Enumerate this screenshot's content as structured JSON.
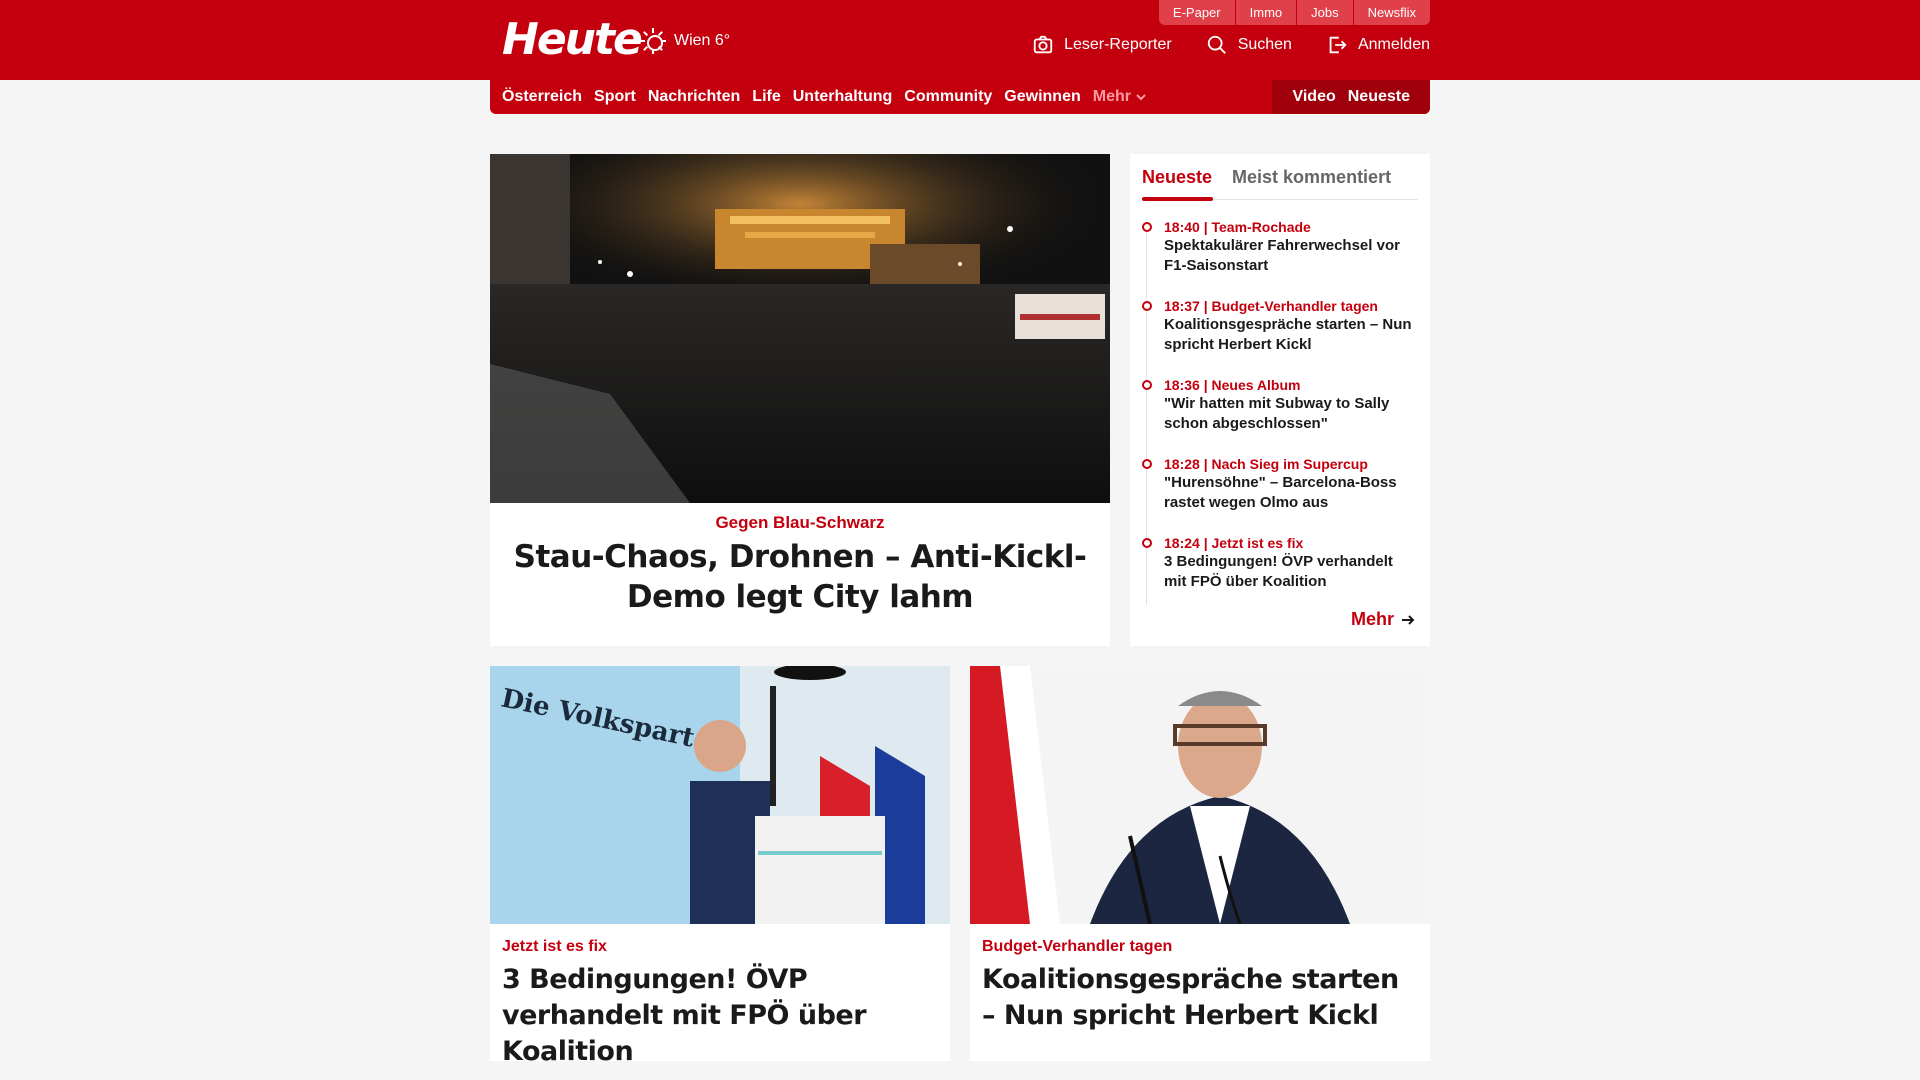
{
  "header": {
    "logo": "Heute",
    "weather": "Wien 6°",
    "top_links": [
      "E-Paper",
      "Immo",
      "Jobs",
      "Newsflix"
    ],
    "actions": {
      "reporter": "Leser-Reporter",
      "search": "Suchen",
      "login": "Anmelden"
    }
  },
  "nav": {
    "items": [
      "Österreich",
      "Sport",
      "Nachrichten",
      "Life",
      "Unterhaltung",
      "Community",
      "Gewinnen"
    ],
    "more": "Mehr",
    "right": [
      "Video",
      "Neueste"
    ]
  },
  "hero": {
    "kicker": "Gegen Blau-Schwarz",
    "title": "Stau-Chaos, Drohnen – Anti-Kickl-Demo legt City lahm"
  },
  "sidebar": {
    "tabs": [
      "Neueste",
      "Meist kommentiert"
    ],
    "items": [
      {
        "meta": "18:40 | Team-Rochade",
        "title": "Spektakulärer Fahrerwechsel vor F1-Saisonstart"
      },
      {
        "meta": "18:37 | Budget-Verhandler tagen",
        "title": "Koalitionsgespräche starten – Nun spricht Herbert Kickl"
      },
      {
        "meta": "18:36 | Neues Album",
        "title": "\"Wir hatten mit Subway to Sally schon abgeschlossen\""
      },
      {
        "meta": "18:28 | Nach Sieg im Supercup",
        "title": "\"Hurensöhne\" – Barcelona-Boss rastet wegen Olmo aus"
      },
      {
        "meta": "18:24 | Jetzt ist es fix",
        "title": "3 Bedingungen! ÖVP verhandelt mit FPÖ über Koalition"
      }
    ],
    "more": "Mehr"
  },
  "cards": [
    {
      "kicker": "Jetzt ist es fix",
      "title": "3 Bedingungen! ÖVP verhandelt mit FPÖ über Koalition",
      "image_text": "Die Volkspartei"
    },
    {
      "kicker": "Budget-Verhandler tagen",
      "title": "Koalitionsgespräche starten – Nun spricht Herbert Kickl"
    }
  ],
  "colors": {
    "brand": "#c4000f",
    "background": "#f5f5f5"
  }
}
